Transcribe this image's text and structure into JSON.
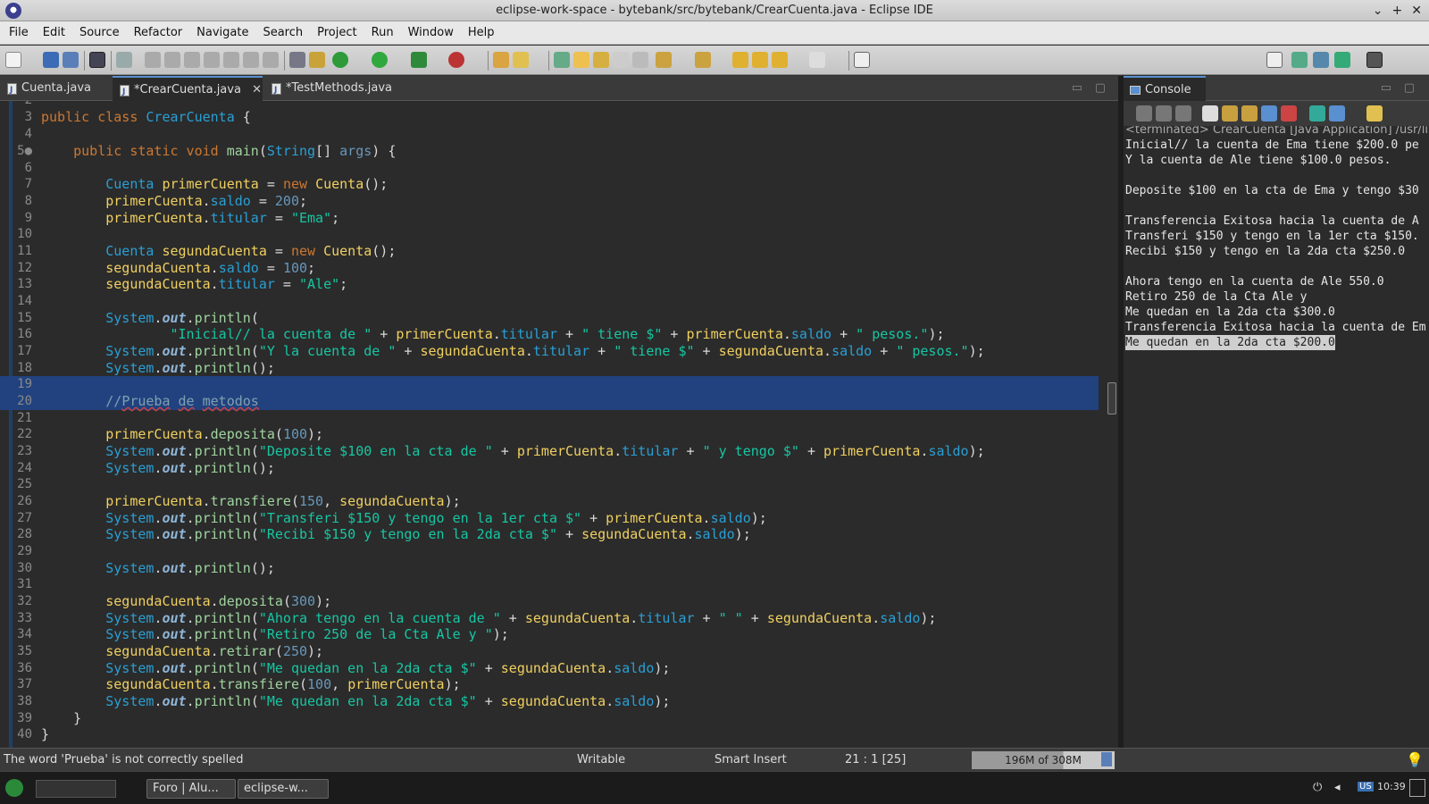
{
  "window": {
    "title": "eclipse-work-space - bytebank/src/bytebank/CrearCuenta.java - Eclipse IDE"
  },
  "menu": [
    "File",
    "Edit",
    "Source",
    "Refactor",
    "Navigate",
    "Search",
    "Project",
    "Run",
    "Window",
    "Help"
  ],
  "tabs": [
    {
      "label": "Cuenta.java"
    },
    {
      "label": "*CrearCuenta.java",
      "close": "✕"
    },
    {
      "label": "*TestMethods.java"
    }
  ],
  "console": {
    "tab_label": "Console",
    "close": "✕",
    "terminated": "<terminated> CrearCuenta [Java Application] /usr/li",
    "lines": [
      "Inicial// la cuenta de Ema tiene $200.0 pe",
      "Y la cuenta de Ale tiene $100.0 pesos.",
      "",
      "Deposite $100 en la cta de Ema y tengo $30",
      "",
      "Transferencia Exitosa hacia la cuenta de A",
      "Transferi $150 y tengo en la 1er cta $150.",
      "Recibi $150 y tengo en la 2da cta $250.0",
      "",
      "Ahora tengo en la cuenta de Ale 550.0",
      "Retiro 250 de la Cta Ale y",
      "Me quedan en la 2da cta $300.0",
      "Transferencia Exitosa hacia la cuenta de Em",
      "Me quedan en la 2da cta $200.0"
    ]
  },
  "status": {
    "message": "The word 'Prueba' is not correctly spelled",
    "writable": "Writable",
    "insert_mode": "Smart Insert",
    "position": "21 : 1 [25]",
    "heap": "196M of 308M",
    "heap_used_fraction": 0.64
  },
  "taskbar": {
    "tasks": [
      "Foro | Alu...",
      "eclipse-w..."
    ],
    "clock": "10:39",
    "lang": "US"
  }
}
